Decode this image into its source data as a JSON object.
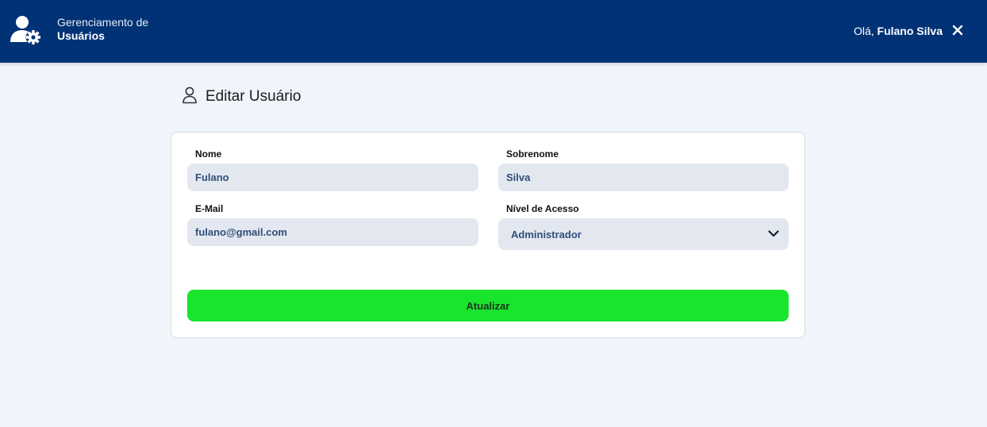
{
  "header": {
    "title_line1": "Gerenciamento de",
    "title_line2": "Usuários",
    "greeting_prefix": "Olá,",
    "user_name": "Fulano Silva",
    "logo_icon": "user-gear-icon",
    "close_icon": "close-icon",
    "background_color": "#003275"
  },
  "page": {
    "title": "Editar Usuário",
    "title_icon": "user-icon"
  },
  "form": {
    "nome": {
      "label": "Nome",
      "value": "Fulano"
    },
    "sobrenome": {
      "label": "Sobrenome",
      "value": "Silva"
    },
    "email": {
      "label": "E-Mail",
      "value": "fulano@gmail.com"
    },
    "nivel_acesso": {
      "label": "Nível de Acesso",
      "selected": "Administrador"
    },
    "submit_label": "Atualizar",
    "submit_color": "#19e52c"
  }
}
